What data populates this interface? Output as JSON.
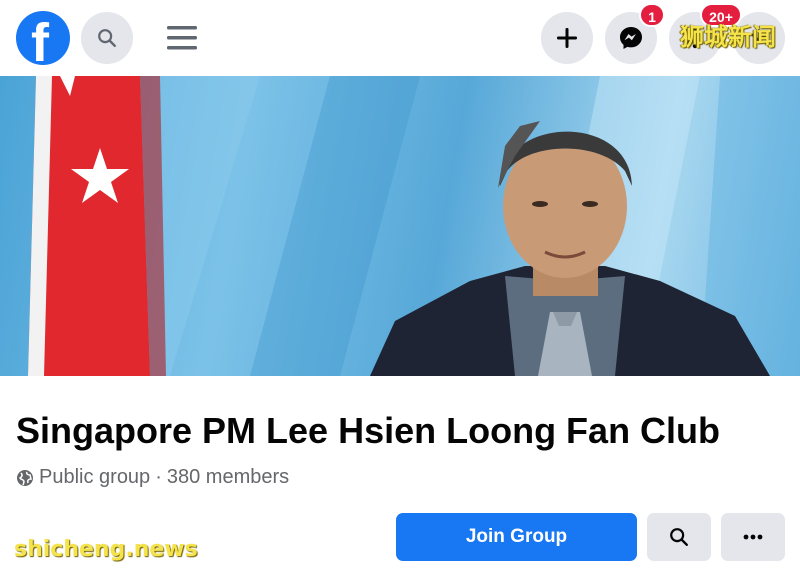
{
  "topbar": {
    "logo": "f",
    "icons": {
      "search": "search-icon",
      "menu": "menu-icon",
      "add": "plus-icon",
      "messenger": "messenger-icon",
      "notifications": "bell-icon",
      "account": "account-icon"
    },
    "messenger_badge": "1",
    "notifications_badge": "20+"
  },
  "watermarks": {
    "top": "狮城新闻",
    "bottom": "shicheng.news"
  },
  "group": {
    "name": "Singapore PM Lee Hsien Loong Fan Club",
    "privacy": "Public group",
    "separator": "·",
    "members": "380 members"
  },
  "actions": {
    "join_label": "Join Group",
    "search_icon": "search-icon",
    "more_icon": "more-icon"
  },
  "colors": {
    "brand": "#1877f2",
    "badge": "#e41e3f",
    "button_gray": "#e4e6eb",
    "flag_red": "#e0282e"
  }
}
